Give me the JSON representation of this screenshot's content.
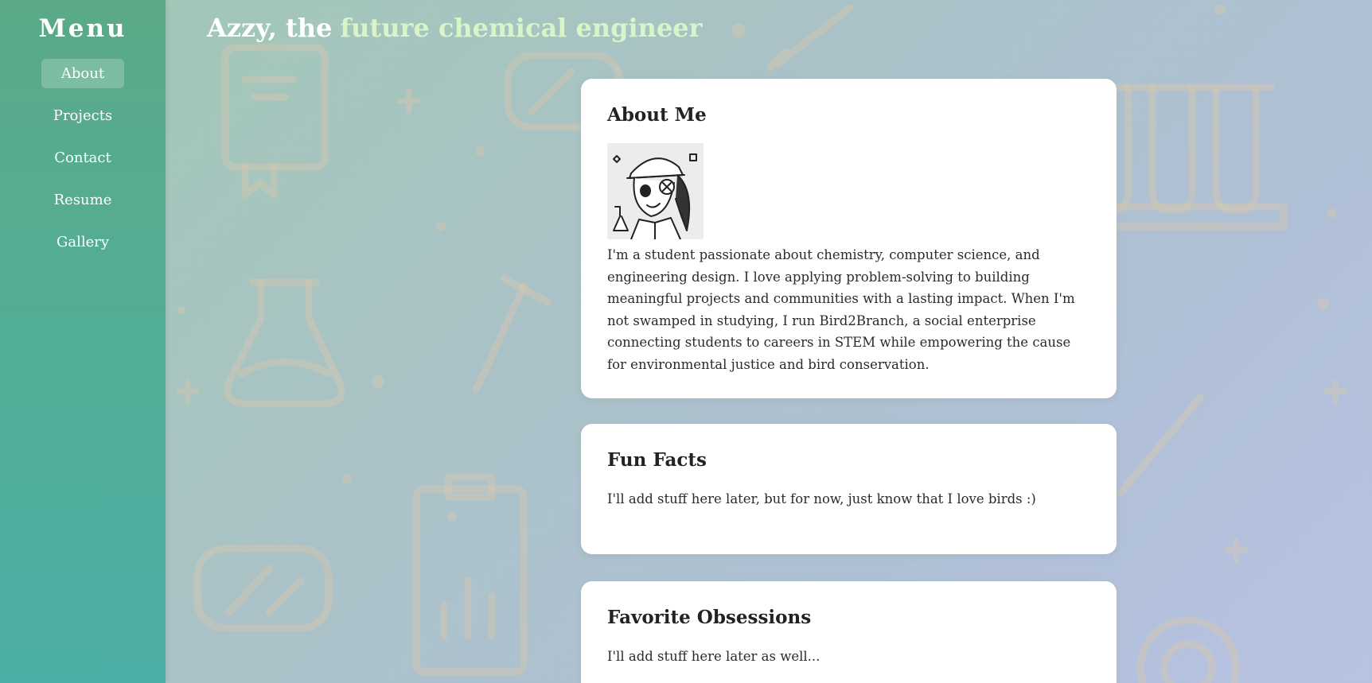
{
  "sidebar": {
    "title": "Menu",
    "items": [
      {
        "label": "About",
        "active": true
      },
      {
        "label": "Projects",
        "active": false
      },
      {
        "label": "Contact",
        "active": false
      },
      {
        "label": "Resume",
        "active": false
      },
      {
        "label": "Gallery",
        "active": false
      }
    ]
  },
  "header": {
    "name": "Azzy, the",
    "role": "future chemical engineer"
  },
  "about": {
    "title": "About Me",
    "avatar_icon": "cartoon-portrait-icon",
    "text": "I'm a student passionate about chemistry, computer science, and engineering design. I love applying problem-solving to building meaningful projects and communities with a lasting impact. When I'm not swamped in studying, I run Bird2Branch, a social enterprise connecting students to careers in STEM while empowering the cause for environmental justice and bird conservation."
  },
  "fun_facts": {
    "title": "Fun Facts",
    "text": "I'll add stuff here later, but for now, just know that I love birds :)"
  },
  "favorite_obsessions": {
    "title": "Favorite Obsessions",
    "text": "I'll add stuff here later as well..."
  },
  "colors": {
    "sidebar_top": "#5aaa87",
    "sidebar_bottom": "#4cada4",
    "header_name": "#ffffff",
    "header_role": "#d8f5c9",
    "card_bg": "#ffffff"
  }
}
